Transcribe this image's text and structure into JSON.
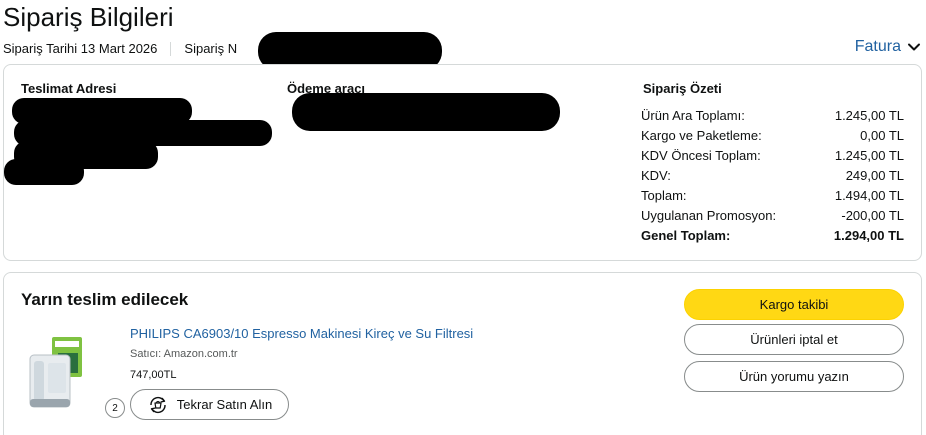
{
  "header": {
    "title": "Sipariş Bilgileri",
    "order_date": "Sipariş Tarihi 13 Mart 2026",
    "order_number_label": "Sipariş N",
    "invoice_label": "Fatura"
  },
  "summary": {
    "shipping_heading": "Teslimat Adresi",
    "payment_heading": "Ödeme aracı",
    "order_summary_heading": "Sipariş Özeti",
    "rows": [
      {
        "label": "Ürün Ara Toplamı:",
        "value": "1.245,00 TL"
      },
      {
        "label": "Kargo ve Paketleme:",
        "value": "0,00 TL"
      },
      {
        "label": "KDV Öncesi Toplam:",
        "value": "1.245,00 TL"
      },
      {
        "label": "KDV:",
        "value": "249,00 TL"
      },
      {
        "label": "Toplam:",
        "value": "1.494,00 TL"
      },
      {
        "label": "Uygulanan Promosyon:",
        "value": "-200,00 TL"
      }
    ],
    "grand_total": {
      "label": "Genel Toplam:",
      "value": "1.294,00 TL"
    }
  },
  "delivery": {
    "status": "Yarın teslim edilecek",
    "product_title": "PHILIPS CA6903/10 Espresso Makinesi Kireç ve Su Filtresi",
    "seller": "Satıcı: Amazon.com.tr",
    "price": "747,00TL",
    "quantity": "2",
    "buy_again_label": "Tekrar Satın Alın",
    "buttons": {
      "track": "Kargo takibi",
      "cancel": "Ürünleri iptal et",
      "review": "Ürün yorumu yazın"
    }
  },
  "colors": {
    "link": "#2162a1",
    "primary_button": "#ffd814",
    "border": "#d5d9d9"
  }
}
